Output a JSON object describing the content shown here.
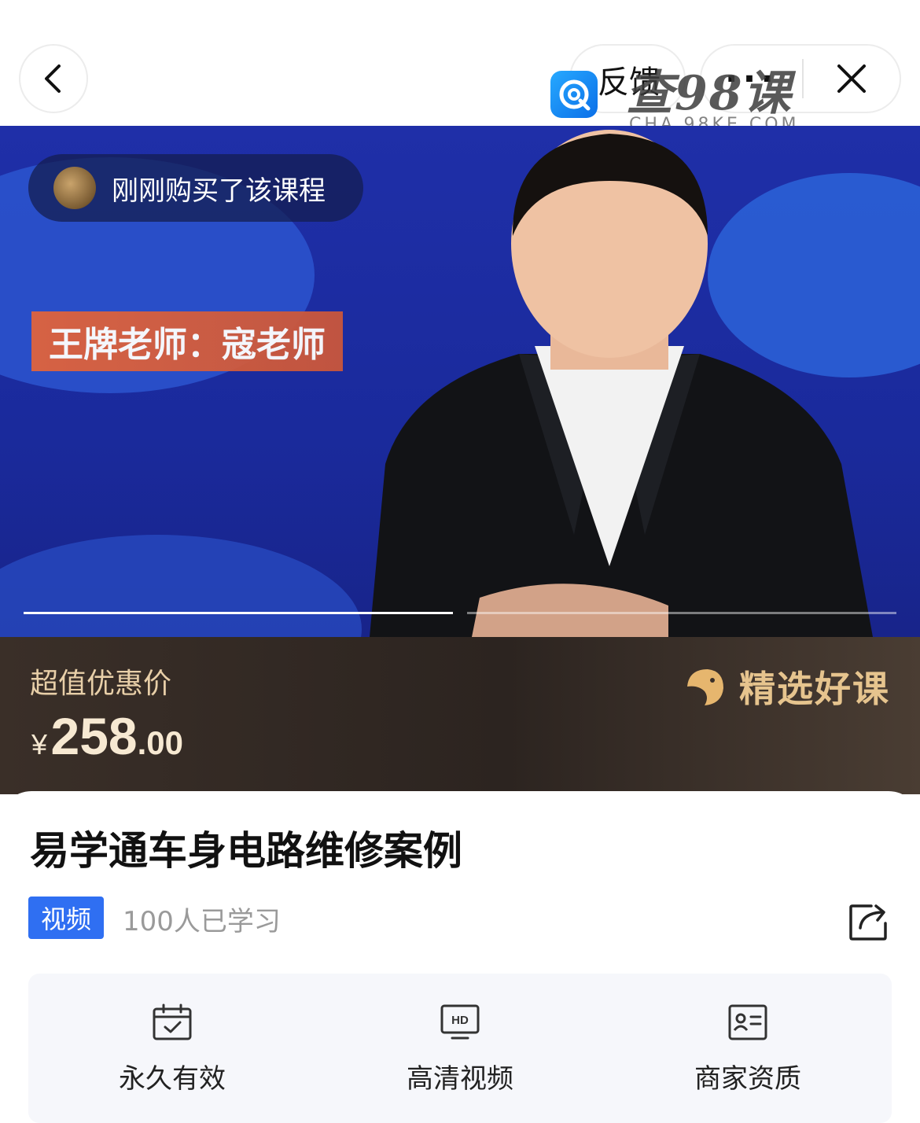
{
  "nav": {
    "feedback_label": "反馈",
    "more_label": "···",
    "watermark_text": "查98课",
    "watermark_sub": "CHA.98KE.COM"
  },
  "banner": {
    "buyer_text": "刚刚购买了该课程",
    "teacher_tag": "王牌老师：寇老师",
    "slide_count": 2,
    "active_slide": 1
  },
  "price": {
    "label": "超值优惠价",
    "currency": "¥",
    "integer": "258",
    "decimal": ".00",
    "badge": "精选好课"
  },
  "course": {
    "title": "易学通车身电路维修案例",
    "type_tag": "视频",
    "learned_count": "100人已学习"
  },
  "features": [
    {
      "label": "永久有效",
      "icon": "calendar-check-icon"
    },
    {
      "label": "高清视频",
      "icon": "hd-monitor-icon"
    },
    {
      "label": "商家资质",
      "icon": "id-card-icon"
    }
  ],
  "colors": {
    "banner_bg": "#1f2fa8",
    "tag_blue": "#2f6ff2",
    "price_text": "#f7e9d2",
    "badge_gold": "#e6c48e"
  }
}
